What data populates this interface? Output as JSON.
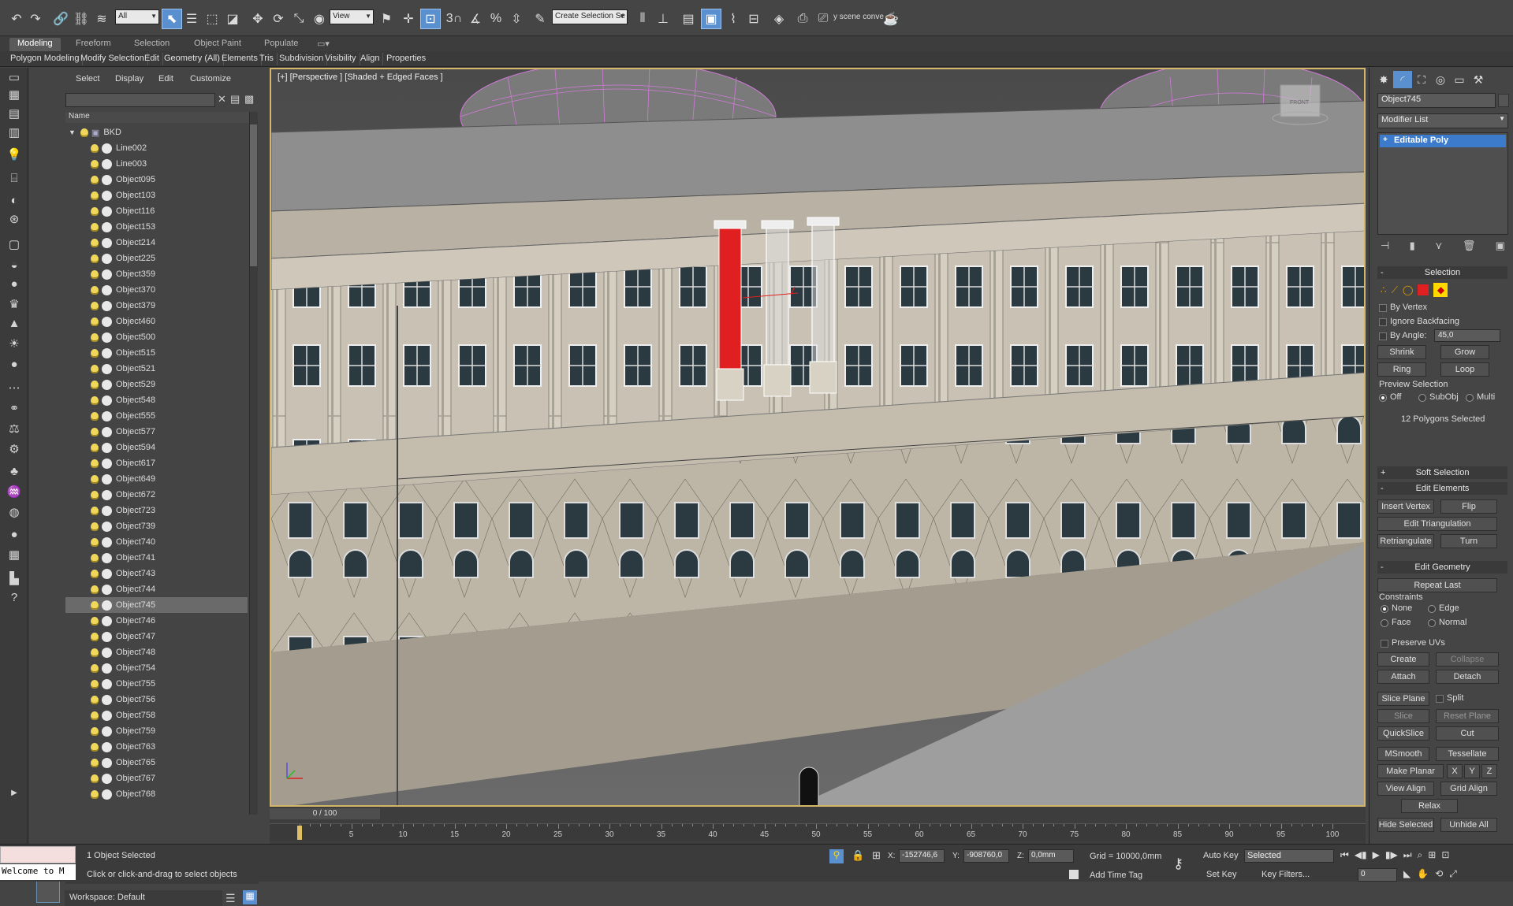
{
  "toolbar": {
    "filter_value": "All",
    "view_value": "View",
    "selection_set_value": "Create Selection Se",
    "scene_converter_label": "y scene conve",
    "snap_label": "3",
    "angle_snap_label": "3",
    "percent_snap_label": "%"
  },
  "ribbon": {
    "tabs": [
      "Modeling",
      "Freeform",
      "Selection",
      "Object Paint",
      "Populate"
    ],
    "buttons": [
      "Polygon Modeling",
      "Modify Selection",
      "Edit",
      "Geometry (All)",
      "Elements",
      "Tris",
      "Subdivision",
      "Visibility",
      "Align",
      "Properties"
    ]
  },
  "scene_explorer": {
    "menus": [
      "Select",
      "Display",
      "Edit",
      "Customize"
    ],
    "column_header": "Name",
    "root": "BKD",
    "items": [
      "Line002",
      "Line003",
      "Object095",
      "Object103",
      "Object116",
      "Object153",
      "Object214",
      "Object225",
      "Object359",
      "Object370",
      "Object379",
      "Object460",
      "Object500",
      "Object515",
      "Object521",
      "Object529",
      "Object548",
      "Object555",
      "Object577",
      "Object594",
      "Object617",
      "Object649",
      "Object672",
      "Object723",
      "Object739",
      "Object740",
      "Object741",
      "Object743",
      "Object744",
      "Object745",
      "Object746",
      "Object747",
      "Object748",
      "Object754",
      "Object755",
      "Object756",
      "Object758",
      "Object759",
      "Object763",
      "Object765",
      "Object767",
      "Object768"
    ],
    "selected": "Object745",
    "workspace": "Workspace: Default"
  },
  "viewport": {
    "label": "[+] [Perspective ] [Shaded + Edged Faces ]",
    "cube_label": "FRONT"
  },
  "command_panel": {
    "object_name": "Object745",
    "modifier_list": "Modifier List",
    "stack_item": "Editable Poly",
    "selection": {
      "title": "Selection",
      "by_vertex": "By Vertex",
      "ignore_backfacing": "Ignore Backfacing",
      "by_angle": "By Angle:",
      "angle_value": "45,0",
      "shrink": "Shrink",
      "grow": "Grow",
      "ring": "Ring",
      "loop": "Loop",
      "preview_selection": "Preview Selection",
      "off": "Off",
      "subobj": "SubObj",
      "multi": "Multi",
      "status": "12 Polygons Selected"
    },
    "soft_selection": "Soft Selection",
    "edit_elements": {
      "title": "Edit Elements",
      "insert_vertex": "Insert Vertex",
      "flip": "Flip",
      "edit_triangulation": "Edit Triangulation",
      "retriangulate": "Retriangulate",
      "turn": "Turn"
    },
    "edit_geometry": {
      "title": "Edit Geometry",
      "repeat_last": "Repeat Last",
      "constraints": "Constraints",
      "none": "None",
      "edge": "Edge",
      "face": "Face",
      "normal": "Normal",
      "preserve_uvs": "Preserve UVs",
      "create": "Create",
      "collapse": "Collapse",
      "attach": "Attach",
      "detach": "Detach",
      "slice_plane": "Slice Plane",
      "split": "Split",
      "slice": "Slice",
      "reset_plane": "Reset Plane",
      "quickslice": "QuickSlice",
      "cut": "Cut",
      "msmooth": "MSmooth",
      "tessellate": "Tessellate",
      "make_planar": "Make Planar",
      "x": "X",
      "y": "Y",
      "z": "Z",
      "view_align": "View Align",
      "grid_align": "Grid Align",
      "relax": "Relax",
      "hide_selected": "Hide Selected",
      "unhide_all": "Unhide All"
    }
  },
  "timeline": {
    "slider": "0 / 100",
    "ticks": [
      "0",
      "5",
      "10",
      "15",
      "20",
      "25",
      "30",
      "35",
      "40",
      "45",
      "50",
      "55",
      "60",
      "65",
      "70",
      "75",
      "80",
      "85",
      "90",
      "95",
      "100"
    ]
  },
  "status": {
    "welcome": "Welcome to M",
    "selected": "1 Object Selected",
    "prompt": "Click or click-and-drag to select objects",
    "x_label": "X:",
    "x_value": "-152746,6",
    "y_label": "Y:",
    "y_value": "-908760,0",
    "z_label": "Z:",
    "z_value": "0,0mm",
    "grid": "Grid = 10000,0mm",
    "add_time_tag": "Add Time Tag",
    "auto_key": "Auto Key",
    "set_key": "Set Key",
    "key_mode": "Selected",
    "key_filters": "Key Filters...",
    "frame": "0"
  },
  "colors": {
    "accent": "#5a8fd0",
    "selected_red": "#e02020",
    "viewport_border": "#d4b66a",
    "wire_purple": "#d07ad8"
  }
}
